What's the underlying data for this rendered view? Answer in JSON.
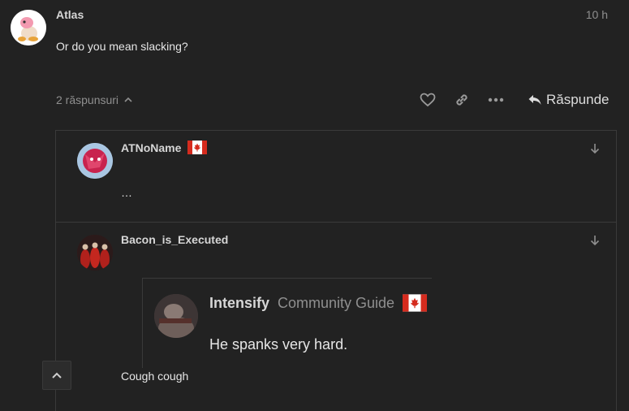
{
  "post": {
    "username": "Atlas",
    "time": "10 h",
    "text": "Or do you mean slacking?"
  },
  "replies_toggle": "2 răspunsuri",
  "reply_button_label": "Răspunde",
  "icons": {
    "like": "heart-icon",
    "link": "link-icon",
    "more": "ellipsis-icon",
    "reply": "reply-arrow-icon",
    "expand": "arrow-down-icon",
    "flag": "canada-flag-icon",
    "scroll_top": "chevron-up-icon"
  },
  "replies": [
    {
      "username": "ATNoName",
      "text": "…"
    },
    {
      "username": "Bacon_is_Executed",
      "quote": {
        "username": "Intensify",
        "title": "Community Guide",
        "text": "He spanks very hard."
      },
      "text": "Cough cough"
    }
  ],
  "colors": {
    "background": "#222222",
    "border": "#3a3a3a",
    "text": "#dddddd",
    "muted": "#8f8f8f",
    "flag_red": "#d52b1e"
  }
}
